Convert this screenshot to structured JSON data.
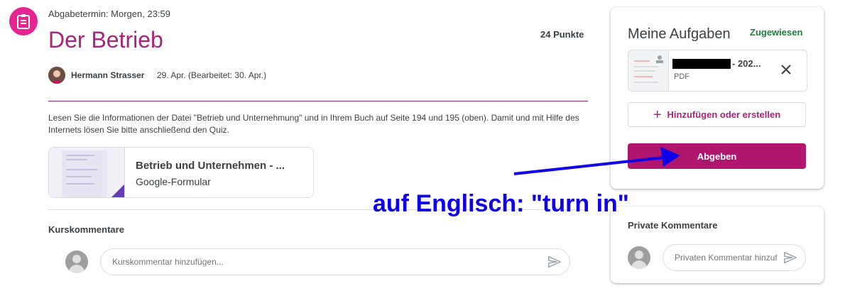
{
  "assignment": {
    "due": "Abgabetermin: Morgen, 23:59",
    "title": "Der Betrieb",
    "points": "24 Punkte",
    "author": "Hermann Strasser",
    "dates": "29. Apr. (Bearbeitet: 30. Apr.)",
    "description": "Lesen Sie die Informationen der Datei \"Betrieb und Unternehmung\" und in Ihrem Buch auf Seite 194 und 195 (oben). Damit und mit Hilfe des Internets lösen Sie bitte anschließend den Quiz.",
    "attachment": {
      "title": "Betrieb und Unternehmen - ...",
      "type": "Google-Formular"
    }
  },
  "course_comments": {
    "heading": "Kurskommentare",
    "placeholder": "Kurskommentar hinzufügen..."
  },
  "my_work": {
    "title": "Meine Aufgaben",
    "status": "Zugewiesen",
    "file_name": "- 202...",
    "file_type": "PDF",
    "add_label": "Hinzufügen oder erstellen",
    "submit_label": "Abgeben"
  },
  "private_comments": {
    "heading": "Private Kommentare",
    "placeholder": "Privaten Kommentar hinzufügen..."
  },
  "annotation": {
    "text": "auf Englisch: \"turn in\""
  },
  "colors": {
    "accent": "#a8237a",
    "submit": "#b1166e",
    "status": "#188038",
    "annotation": "#0e00e8"
  },
  "icons": [
    "assignment-icon",
    "send-icon",
    "close-icon",
    "plus-icon",
    "avatar-icon"
  ]
}
